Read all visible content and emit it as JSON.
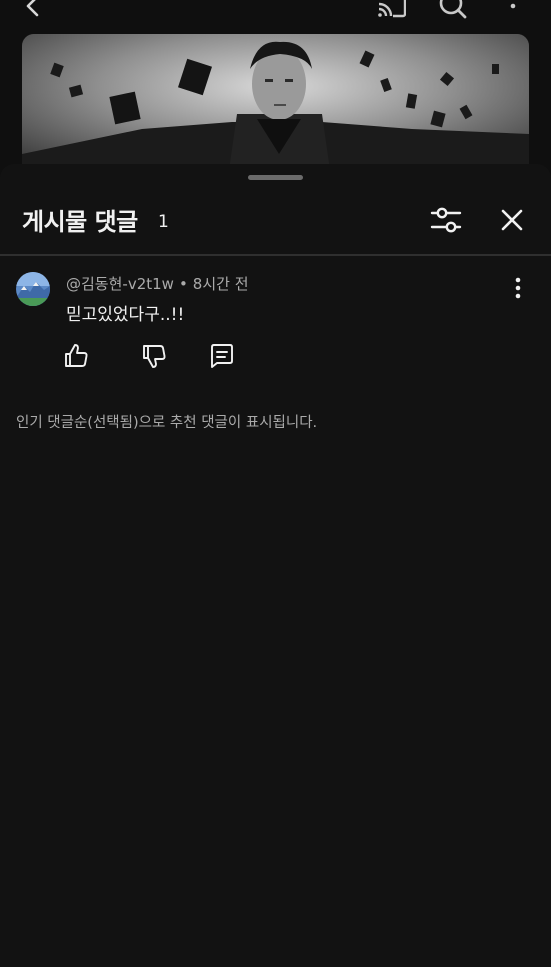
{
  "topbar": {
    "back_icon": "chevron-left-icon",
    "cast_icon": "cast-icon",
    "search_icon": "search-icon",
    "more_icon": "more-vertical-icon"
  },
  "sheet": {
    "title": "게시물 댓글",
    "count": "1",
    "filter_icon": "sliders-icon",
    "close_icon": "close-icon"
  },
  "comment": {
    "author": "@김동현-v2t1w",
    "separator": "•",
    "time": "8시간 전",
    "text": "믿고있었다구..!!",
    "more_icon": "more-vertical-icon",
    "actions": {
      "like_icon": "thumbs-up-icon",
      "dislike_icon": "thumbs-down-icon",
      "reply_icon": "reply-comment-icon"
    }
  },
  "footnote": "인기 댓글순(선택됨)으로 추천 댓글이 표시됩니다.",
  "colors": {
    "background": "#0f0f0f",
    "sheet": "#121212",
    "text_primary": "#f1f1f1",
    "text_secondary": "#aaaaaa"
  }
}
